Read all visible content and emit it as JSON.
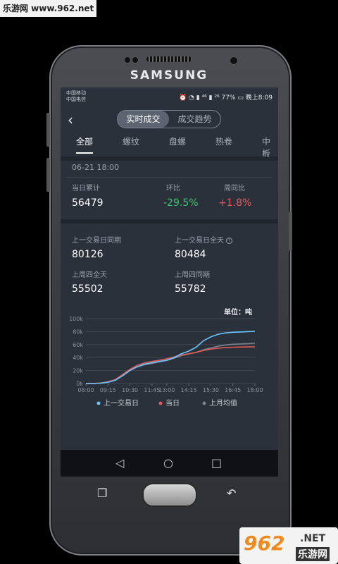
{
  "watermark_top": "乐游网 www.962.net",
  "device": {
    "brand": "SAMSUNG"
  },
  "status": {
    "carrier1": "中国移动",
    "carrier2": "中国电信",
    "right": "⏰ ◔ ▮ ⁴⁶ ▮ ²⁶ 77% ▭ 晚上8:09"
  },
  "header": {
    "back_icon": "chevron-left-icon",
    "seg_active": "实时成交",
    "seg_inactive": "成交趋势"
  },
  "tabs": [
    {
      "label": "全部",
      "active": true
    },
    {
      "label": "螺纹",
      "active": false
    },
    {
      "label": "盘螺",
      "active": false
    },
    {
      "label": "热卷",
      "active": false
    },
    {
      "label": "中板",
      "active": false
    }
  ],
  "summary": {
    "datetime": "06-21 18:00",
    "cum_label": "当日累计",
    "cum_value": "56479",
    "mom_label": "环比",
    "mom_value": "-29.5%",
    "wow_label": "周同比",
    "wow_value": "+1.8%"
  },
  "compare": {
    "prev_same_label": "上一交易日同期",
    "prev_same_value": "80126",
    "prev_full_label": "上一交易日全天",
    "prev_full_value": "80484",
    "lastweek_full_label": "上周四全天",
    "lastweek_full_value": "55502",
    "lastweek_same_label": "上周四同期",
    "lastweek_same_value": "55782"
  },
  "colors": {
    "series_prev": "#69c6ff",
    "series_today": "#e25a57",
    "series_avg": "#7b828c",
    "positive": "#3cc26a",
    "negative": "#e45b5b"
  },
  "chart_data": {
    "type": "line",
    "unit_label": "单位：吨",
    "x": [
      "08:00",
      "08:30",
      "09:00",
      "09:15",
      "09:30",
      "10:00",
      "10:30",
      "11:00",
      "11:30",
      "11:45",
      "12:30",
      "13:00",
      "13:30",
      "14:00",
      "14:15",
      "14:30",
      "15:00",
      "15:30",
      "16:00",
      "16:30",
      "16:45",
      "17:00",
      "17:30",
      "18:00"
    ],
    "xticks": [
      "08:00",
      "09:15",
      "10:30",
      "11:45",
      "13:00",
      "14:15",
      "15:30",
      "16:45",
      "18:00"
    ],
    "yticks": [
      "0k",
      "20k",
      "40k",
      "60k",
      "80k",
      "100k"
    ],
    "ylim": [
      0,
      100000
    ],
    "grid": true,
    "legend_position": "bottom",
    "series": [
      {
        "name": "上一交易日",
        "color": "#69c6ff",
        "values": [
          0,
          0,
          500,
          2000,
          5000,
          12000,
          20000,
          26000,
          30000,
          32000,
          34000,
          36000,
          40000,
          46000,
          50000,
          56000,
          66000,
          72000,
          76000,
          78000,
          79000,
          79500,
          80000,
          80484
        ]
      },
      {
        "name": "当日",
        "color": "#e25a57",
        "values": [
          0,
          0,
          800,
          2500,
          6000,
          14000,
          22000,
          28000,
          32000,
          34000,
          36000,
          38000,
          41000,
          44000,
          46000,
          48000,
          51000,
          53000,
          54500,
          55500,
          56000,
          56200,
          56400,
          56479
        ]
      },
      {
        "name": "上月均值",
        "color": "#7b828c",
        "values": [
          0,
          0,
          600,
          2200,
          5500,
          13000,
          20500,
          25500,
          29000,
          31000,
          33500,
          35500,
          39000,
          43000,
          45500,
          48000,
          52000,
          55000,
          57500,
          59500,
          60500,
          61000,
          61500,
          62000
        ]
      }
    ]
  },
  "navbar": {
    "back_icon": "triangle-back-icon",
    "home_icon": "circle-home-icon",
    "recent_icon": "square-recent-icon"
  },
  "watermark_bottom": {
    "logo": "962",
    "net": ".NET",
    "site": "乐游网"
  }
}
